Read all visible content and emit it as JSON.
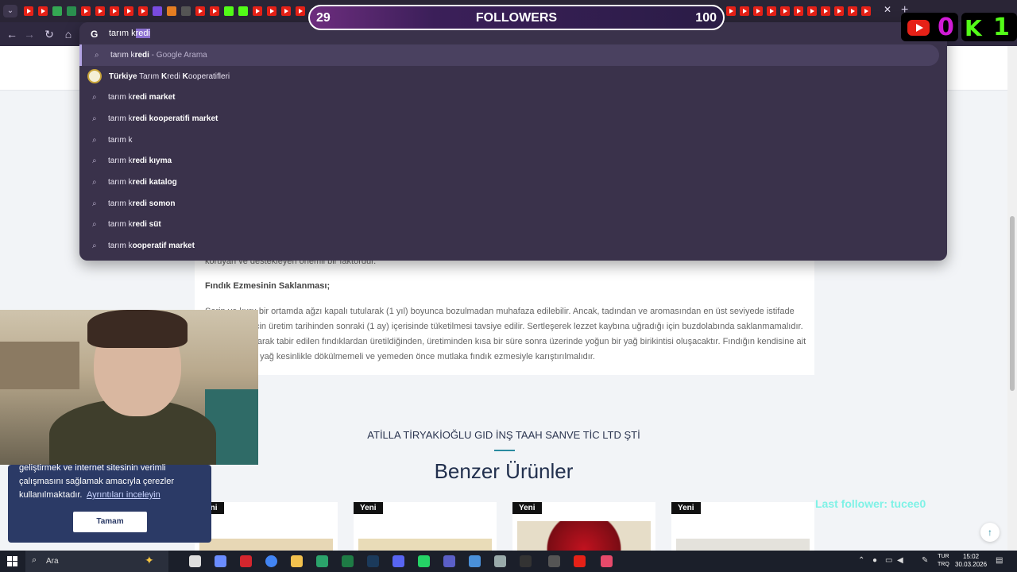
{
  "browser": {
    "omnibox_typed": "tarım k",
    "omnibox_completion": "redi",
    "search_engine_badge": "G",
    "suggestions": [
      {
        "prefix": "tarım k",
        "bold": "redi",
        "suffix": " - Google Arama",
        "icon": "search-icon"
      },
      {
        "prefix": "",
        "bold": "Türkiye",
        "suffix": "",
        "rich": [
          "Türkiye",
          " Tarım ",
          "K",
          "redi ",
          "K",
          "ooperatifleri"
        ],
        "icon": "site-logo"
      },
      {
        "prefix": "tarım k",
        "bold": "redi market",
        "suffix": "",
        "icon": "search-icon"
      },
      {
        "prefix": "tarım k",
        "bold": "redi kooperatifi market",
        "suffix": "",
        "icon": "search-icon"
      },
      {
        "prefix": "tarım k",
        "bold": "",
        "suffix": "",
        "icon": "search-icon"
      },
      {
        "prefix": "tarım k",
        "bold": "redi kıyma",
        "suffix": "",
        "icon": "search-icon"
      },
      {
        "prefix": "tarım k",
        "bold": "redi katalog",
        "suffix": "",
        "icon": "search-icon"
      },
      {
        "prefix": "tarım k",
        "bold": "redi somon",
        "suffix": "",
        "icon": "search-icon"
      },
      {
        "prefix": "tarım k",
        "bold": "redi süt",
        "suffix": "",
        "icon": "search-icon"
      },
      {
        "prefix": "tarım k",
        "bold": "ooperatif market",
        "suffix": "",
        "icon": "search-icon"
      }
    ]
  },
  "overlay": {
    "followers_current": "29",
    "followers_label": "FOLLOWERS",
    "followers_goal": "100",
    "youtube_count": "0",
    "kick_letter": "K",
    "kick_count": "1",
    "last_follower": "Last follower: tucee0"
  },
  "page": {
    "storage_title": "Fındık Ezmesinin Saklanması;",
    "para_top": "koruyan ve destekleyen önemli bir faktördür.",
    "storage_lines": [
      "Serin ve kuru bir ortamda ağzı kapalı tutularak (1 yıl) boyunca bozulmadan muhafaza edilebilir. Ancak, tadından ve aromasından en üst seviyede istifade",
      "edilebilmesi için üretim tarihinden sonraki (1 ay) içerisinde tüketilmesi tavsiye edilir. Sertleşerek lezzet kaybına uğradığı için buzdolabında saklanmamalıdır.",
      "Yağlı fındık olarak tabir edilen fındıklardan üretildiğinden, üretiminden kısa bir süre sonra üzerinde yoğun bir yağ birikintisi oluşacaktır. Fındığın kendisine ait",
      "olan bu doğal yağ kesinlikle dökülmemeli ve yemeden önce mutlaka fındık ezmesiyle karıştırılmalıdır."
    ],
    "company": "ATİLLA TİRYAKİOĞLU GID İNŞ TAAH SANVE TİC LTD ŞTİ",
    "similar_title": "Benzer Ürünler",
    "badges": [
      "Yeni",
      "Yeni",
      "Yeni",
      "Yeni"
    ]
  },
  "cookie": {
    "line1": "geliştirmek ve internet sitesinin verimli",
    "line2": "çalışmasını sağlamak amacıyla çerezler",
    "line3": "kullanılmaktadır.",
    "link": "Ayrıntıları inceleyin",
    "button": "Tamam"
  },
  "taskbar": {
    "search_placeholder": "Ara",
    "lang_top": "TUR",
    "lang_bottom": "TRQ",
    "time": "15:02",
    "date": "30.03.2026"
  },
  "colors": {
    "tab_strip": "#2a2536",
    "omnibox": "#3a324b",
    "accent": "#2a8ba0",
    "cookie_bg": "#2b3a66",
    "last_follower": "#7ff2e6"
  }
}
